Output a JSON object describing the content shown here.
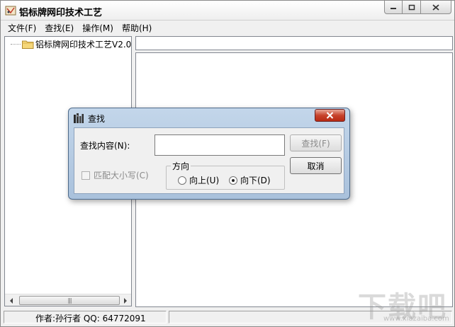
{
  "window": {
    "title": "铝标牌网印技术工艺"
  },
  "menubar": {
    "items": [
      "文件(F)",
      "查找(E)",
      "操作(M)",
      "帮助(H)"
    ]
  },
  "tree": {
    "root_label": "铝标牌网印技术工艺V2.0"
  },
  "statusbar": {
    "text": "作者:孙行者 QQ: 64772091"
  },
  "find_dialog": {
    "title": "查找",
    "label": "查找内容(N):",
    "input_value": "",
    "find_button": "查找(F)",
    "cancel_button": "取消",
    "match_case": "匹配大小写(C)",
    "direction_label": "方向",
    "direction_up": "向上(U)",
    "direction_down": "向下(D)",
    "selected_direction": "down"
  },
  "watermark": {
    "text": "下载吧",
    "url": "www.xiazaiba.com"
  }
}
